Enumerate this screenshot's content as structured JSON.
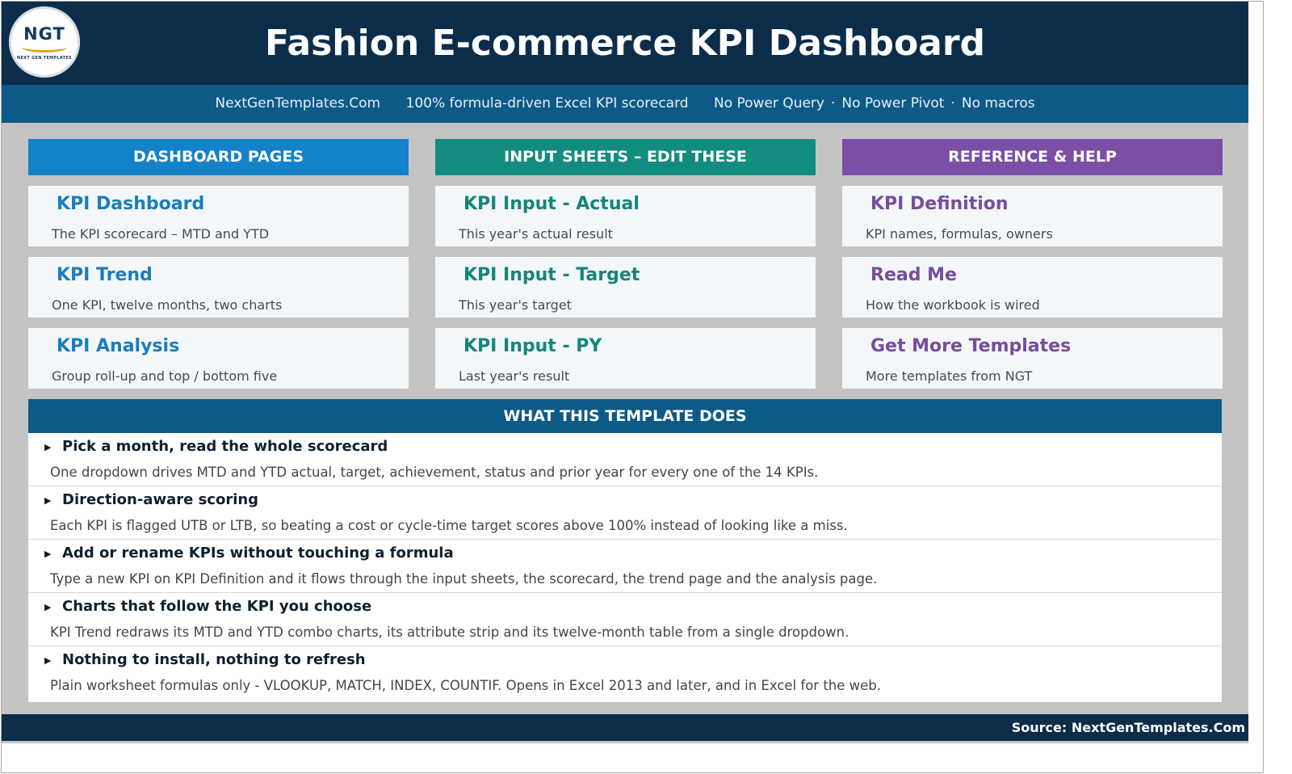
{
  "logo": {
    "text": "NGT",
    "subtext": "NEXT GEN TEMPLATES"
  },
  "header": {
    "title": "Fashion E-commerce KPI Dashboard",
    "site": "NextGenTemplates.Com",
    "tagline": "100% formula-driven Excel KPI scorecard",
    "no_power_query": "No Power Query",
    "no_power_pivot": "No Power Pivot",
    "no_macros": "No macros",
    "separator": "·"
  },
  "columns": [
    {
      "heading": "DASHBOARD PAGES",
      "color": "#1482c8",
      "items": [
        {
          "title": "KPI Dashboard",
          "desc": "The KPI scorecard – MTD and YTD"
        },
        {
          "title": "KPI Trend",
          "desc": "One KPI, twelve months, two charts"
        },
        {
          "title": "KPI Analysis",
          "desc": "Group roll-up and top / bottom five"
        }
      ]
    },
    {
      "heading": "INPUT SHEETS – EDIT THESE",
      "color": "#128c7e",
      "items": [
        {
          "title": "KPI Input - Actual",
          "desc": "This year's actual result"
        },
        {
          "title": "KPI Input - Target",
          "desc": "This year's target"
        },
        {
          "title": "KPI Input - PY",
          "desc": "Last year's result"
        }
      ]
    },
    {
      "heading": "REFERENCE & HELP",
      "color": "#7b4fa6",
      "items": [
        {
          "title": "KPI Definition",
          "desc": "KPI names, formulas, owners"
        },
        {
          "title": "Read Me",
          "desc": "How the workbook is wired"
        },
        {
          "title": "Get More Templates",
          "desc": "More templates from NGT"
        }
      ]
    }
  ],
  "what": {
    "heading": "WHAT THIS TEMPLATE DOES",
    "features": [
      {
        "title": "Pick a month, read the whole scorecard",
        "desc": "One dropdown drives MTD and YTD actual, target, achievement, status and prior year for every one of the 14 KPIs."
      },
      {
        "title": "Direction-aware scoring",
        "desc": "Each KPI is flagged UTB or LTB, so beating a cost or cycle-time target scores above 100% instead of looking like a miss."
      },
      {
        "title": "Add or rename KPIs without touching a formula",
        "desc": "Type a new KPI on KPI Definition and it flows through the input sheets, the scorecard, the trend page and the analysis page."
      },
      {
        "title": "Charts that follow the KPI you choose",
        "desc": "KPI Trend redraws its MTD and YTD combo charts, its attribute strip and its twelve-month table from a single dropdown."
      },
      {
        "title": "Nothing to install, nothing to refresh",
        "desc": "Plain worksheet formulas only - VLOOKUP, MATCH, INDEX, COUNTIF. Opens in Excel 2013 and later, and in Excel for the web."
      }
    ]
  },
  "footer": {
    "source": "Source: NextGenTemplates.Com"
  }
}
